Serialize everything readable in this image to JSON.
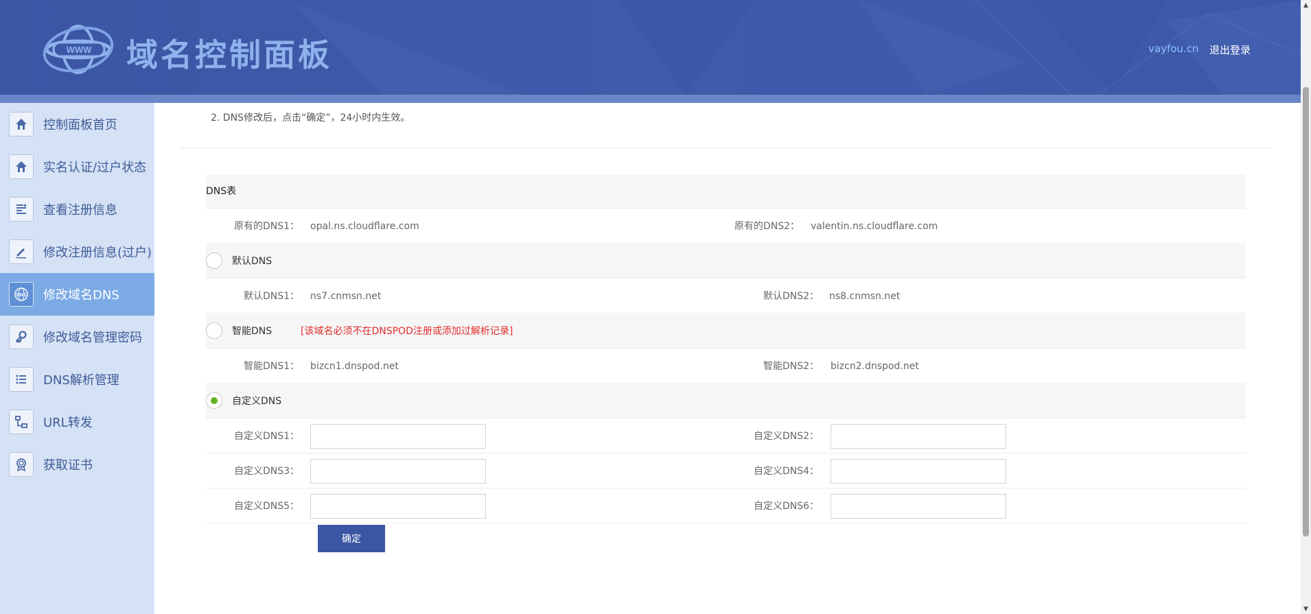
{
  "header": {
    "brand_title": "域名控制面板",
    "logo_text": "WWW",
    "user_domain": "vayfou.cn",
    "logout": "退出登录"
  },
  "sidebar": {
    "items": [
      {
        "label": "控制面板首页",
        "icon": "home-icon"
      },
      {
        "label": "实名认证/过户状态",
        "icon": "home-icon"
      },
      {
        "label": "查看注册信息",
        "icon": "document-list-icon"
      },
      {
        "label": "修改注册信息(过户)",
        "icon": "pencil-icon"
      },
      {
        "label": "修改域名DNS",
        "icon": "dns-globe-icon",
        "active": true
      },
      {
        "label": "修改域名管理密码",
        "icon": "key-icon"
      },
      {
        "label": "DNS解析管理",
        "icon": "list-icon"
      },
      {
        "label": "URL转发",
        "icon": "network-icon"
      },
      {
        "label": "获取证书",
        "icon": "certificate-icon"
      }
    ]
  },
  "main": {
    "note": "2. DNS修改后，点击“确定”，24小时内生效。",
    "table_title": "DNS表",
    "original": {
      "dns1_label": "原有的DNS1：",
      "dns1_value": "opal.ns.cloudflare.com",
      "dns2_label": "原有的DNS2：",
      "dns2_value": "valentin.ns.cloudflare.com"
    },
    "default_option": {
      "label": "默认DNS",
      "dns1_label": "默认DNS1：",
      "dns1_value": "ns7.cnmsn.net",
      "dns2_label": "默认DNS2：",
      "dns2_value": "ns8.cnmsn.net"
    },
    "smart_option": {
      "label": "智能DNS",
      "warning": "[该域名必须不在DNSPOD注册或添加过解析记录]",
      "dns1_label": "智能DNS1：",
      "dns1_value": "bizcn1.dnspod.net",
      "dns2_label": "智能DNS2：",
      "dns2_value": "bizcn2.dnspod.net"
    },
    "custom_option": {
      "label": "自定义DNS",
      "selected": true,
      "fields": {
        "dns1_label": "自定义DNS1：",
        "dns1_value": "",
        "dns2_label": "自定义DNS2：",
        "dns2_value": "",
        "dns3_label": "自定义DNS3：",
        "dns3_value": "",
        "dns4_label": "自定义DNS4：",
        "dns4_value": "",
        "dns5_label": "自定义DNS5：",
        "dns5_value": "",
        "dns6_label": "自定义DNS6：",
        "dns6_value": ""
      }
    },
    "confirm_button": "确定"
  },
  "colors": {
    "header_bg": "#3d58a8",
    "brand_text": "#8fb2ec",
    "sidebar_bg": "#d5e1f5",
    "sidebar_active": "#7baae5",
    "warning": "#e02c2c",
    "radio_checked": "#5fb21e",
    "button_bg": "#3b56a3"
  }
}
